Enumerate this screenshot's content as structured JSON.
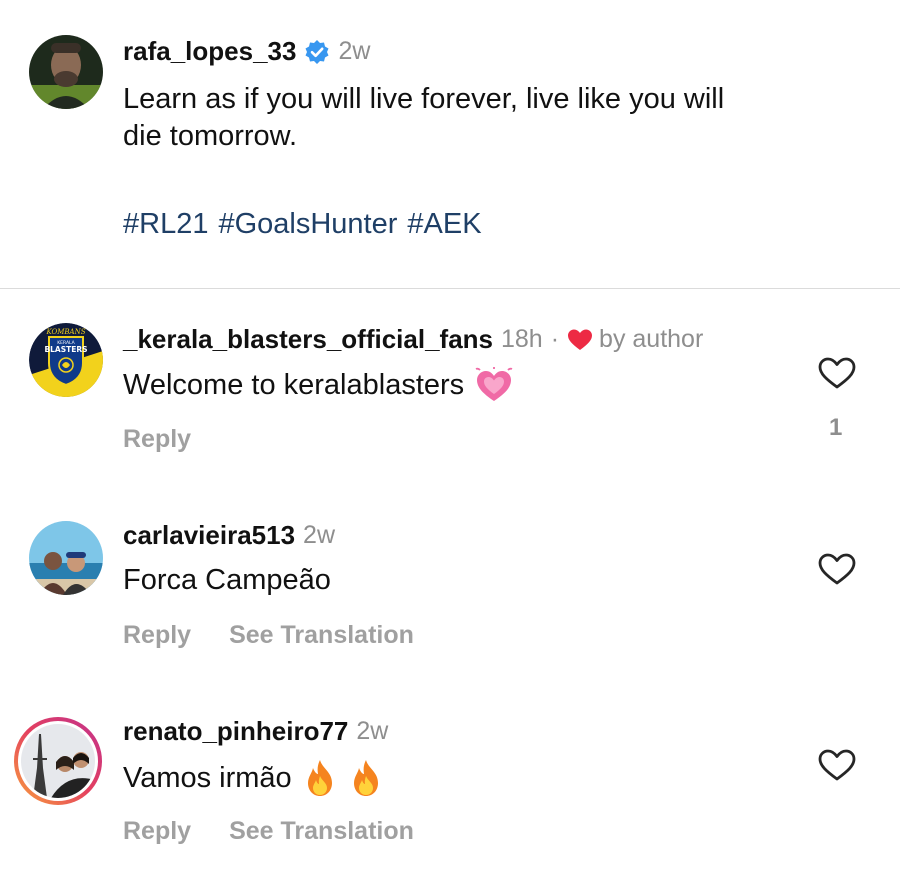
{
  "caption": {
    "username": "rafa_lopes_33",
    "time": "2w",
    "text_line1": "Learn as if you will live forever, live like you will",
    "text_line2": "die tomorrow.",
    "hashtags": [
      "#RL21",
      "#GoalsHunter",
      "#AEK"
    ]
  },
  "comments": [
    {
      "username": "_kerala_blasters_official_fans",
      "time": "18h",
      "separator": "·",
      "by_author": "by author",
      "text": "Welcome to keralablasters",
      "reply": "Reply",
      "likes": "1",
      "avatar_text_top": "KOMBANS",
      "avatar_text_mid": "KERALA",
      "avatar_text_main": "BLASTERS"
    },
    {
      "username": "carlavieira513",
      "time": "2w",
      "text": "Forca Campeão",
      "reply": "Reply",
      "see_translation": "See Translation"
    },
    {
      "username": "renato_pinheiro77",
      "time": "2w",
      "text": "Vamos irmão",
      "reply": "Reply",
      "see_translation": "See Translation"
    }
  ],
  "colors": {
    "hashtag": "#1f3f66",
    "secondary": "#8e8e8e",
    "verified": "#3897f0",
    "heart_red": "#ed2a44",
    "story_ring_start": "#f9a23c",
    "story_ring_end": "#c1318e"
  },
  "icons": [
    "verified-badge-icon",
    "red-heart-icon",
    "growing-heart-emoji",
    "fire-emoji",
    "heart-outline-icon"
  ]
}
